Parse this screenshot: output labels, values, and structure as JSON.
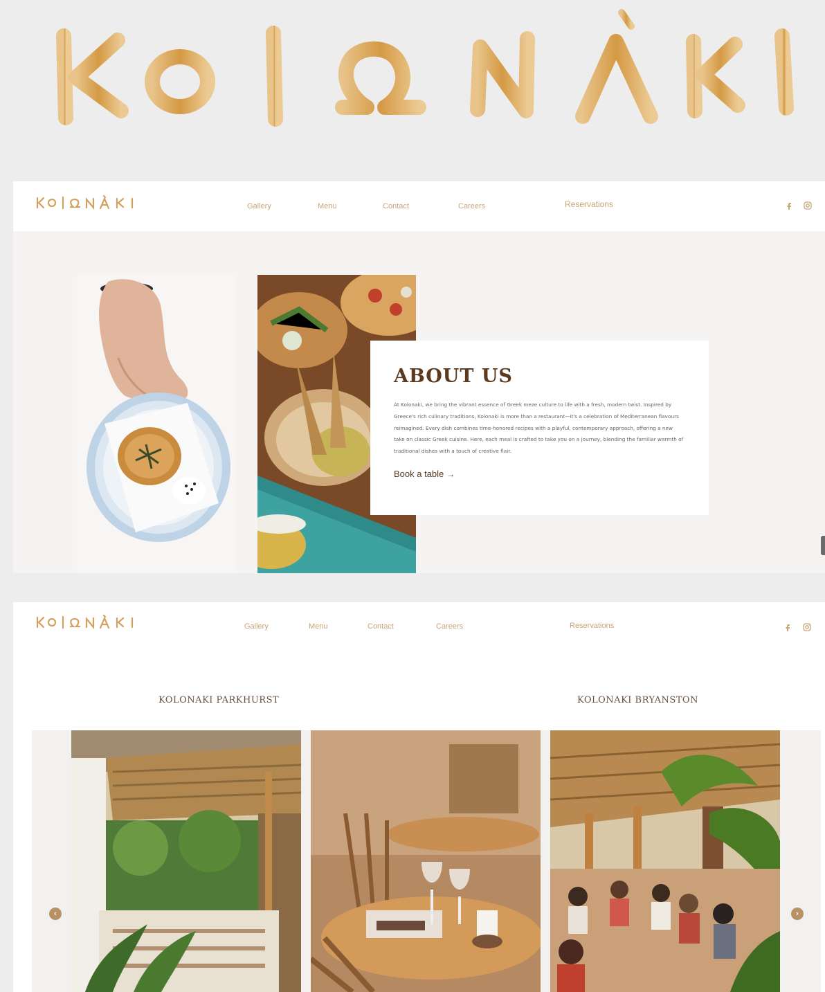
{
  "brand": {
    "name": "KOLΩNÁKI",
    "color": "#d8a355"
  },
  "nav": {
    "logo": "KOΙΩΝÁΚΙ",
    "links": [
      "Gallery",
      "Menu",
      "Contact",
      "Careers"
    ],
    "reservations": "Reservations",
    "social": [
      "facebook-icon",
      "instagram-icon"
    ],
    "accent_color": "#c8a579"
  },
  "about": {
    "title": "ABOUT US",
    "text": "At Kolonaki, we bring the vibrant essence of Greek meze culture to life with a fresh, modern twist. Inspired by Greece's rich culinary traditions, Kolonaki is more than a restaurant—it's a celebration of Mediterranean flavours reimagined. Every dish combines time-honored recipes with a playful, contemporary approach, offering a new take on classic Greek cuisine. Here, each meal is crafted to take you on a journey, blending the familiar warmth of traditional dishes with a touch of creative flair.",
    "cta": "Book a table",
    "cta_arrow": "→"
  },
  "locations": {
    "parkhurst": "KOLONAKI PARKHURST",
    "bryanston": "KOLONAKI BRYANSTON",
    "prev": "‹",
    "next": "›"
  }
}
